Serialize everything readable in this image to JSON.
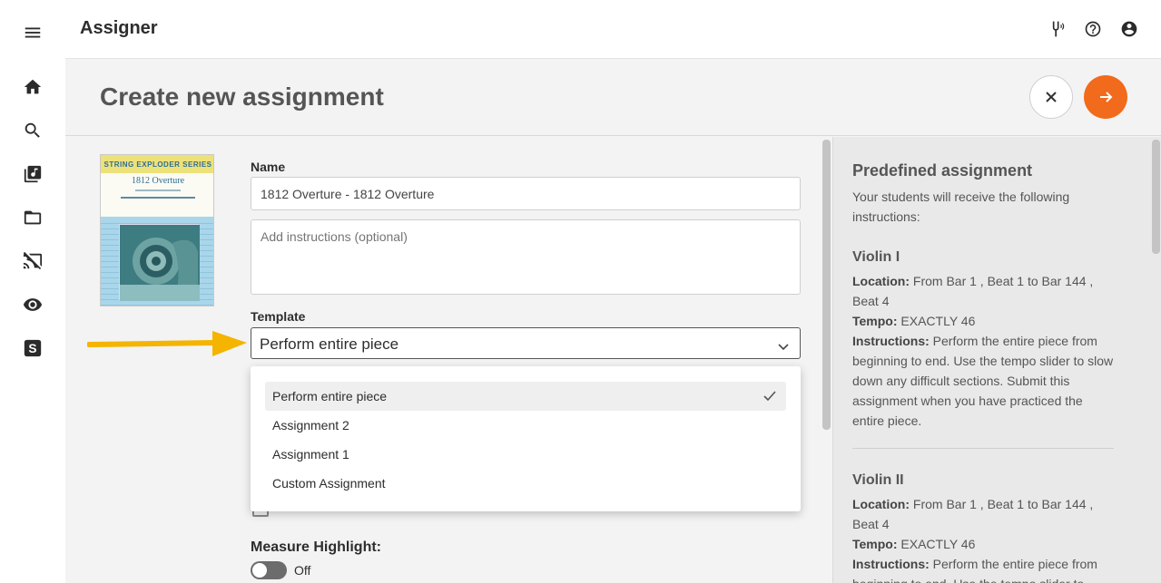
{
  "app": {
    "title": "Assigner"
  },
  "nav": {
    "menu": "menu-icon",
    "items": [
      "home-icon",
      "search-icon",
      "library-music-icon",
      "folder-icon",
      "cast-off-icon",
      "eye-icon",
      "s-badge-icon"
    ]
  },
  "header_icons": [
    "tuning-fork-icon",
    "help-icon",
    "account-icon"
  ],
  "page": {
    "title": "Create new assignment"
  },
  "cover": {
    "series": "STRING EXPLODER SERIES",
    "piece": "1812 Overture"
  },
  "form": {
    "name_label": "Name",
    "name_value": "1812 Overture - 1812 Overture",
    "instructions_placeholder": "Add instructions (optional)",
    "template_label": "Template",
    "template_value": "Perform entire piece",
    "template_options": [
      "Perform entire piece",
      "Assignment 2",
      "Assignment 1",
      "Custom Assignment"
    ],
    "measure_label": "Measure Highlight:",
    "measure_toggle": "Off"
  },
  "panel": {
    "title": "Predefined assignment",
    "subtitle": "Your students will receive the following instructions:",
    "location_label": "Location:",
    "tempo_label": "Tempo:",
    "instructions_label": "Instructions:",
    "parts": [
      {
        "name": "Violin I",
        "location": "From Bar 1 , Beat 1 to Bar 144 , Beat 4",
        "tempo": "EXACTLY 46",
        "instructions": "Perform the entire piece from beginning to end. Use the tempo slider to slow down any difficult sections. Submit this assignment when you have practiced the entire piece."
      },
      {
        "name": "Violin II",
        "location": "From Bar 1 , Beat 1 to Bar 144 , Beat 4",
        "tempo": "EXACTLY 46",
        "instructions": "Perform the entire piece from beginning to end. Use the tempo slider to"
      }
    ]
  },
  "colors": {
    "accent": "#f26a1b",
    "pointer_arrow": "#f4b400",
    "panel_bg": "#e9e9e9",
    "content_bg": "#f3f3f3"
  }
}
